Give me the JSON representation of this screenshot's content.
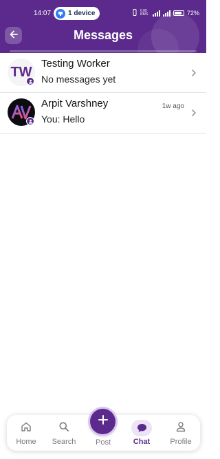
{
  "status_bar": {
    "time": "14:07",
    "device_pill": "1 device",
    "net_speed": "0.00 KB/S",
    "battery": "72%"
  },
  "header": {
    "title": "Messages",
    "back_icon": "arrow-left-icon",
    "background": "#5b2a8c"
  },
  "chats": [
    {
      "avatar_initials": "TW",
      "name": "Testing Worker",
      "preview": "No messages yet",
      "time": ""
    },
    {
      "avatar_logo": "AV",
      "name": "Arpit Varshney",
      "preview": "You: Hello",
      "time": "1w ago"
    }
  ],
  "bottom_nav": {
    "items": [
      {
        "label": "Home",
        "icon": "home-icon"
      },
      {
        "label": "Search",
        "icon": "search-icon"
      },
      {
        "label": "Post",
        "icon": "plus-icon"
      },
      {
        "label": "Chat",
        "icon": "chat-bubble-icon",
        "active": true
      },
      {
        "label": "Profile",
        "icon": "person-icon"
      }
    ]
  },
  "colors": {
    "accent": "#5b2a8c",
    "active_tab_bg": "#ece3f5"
  }
}
